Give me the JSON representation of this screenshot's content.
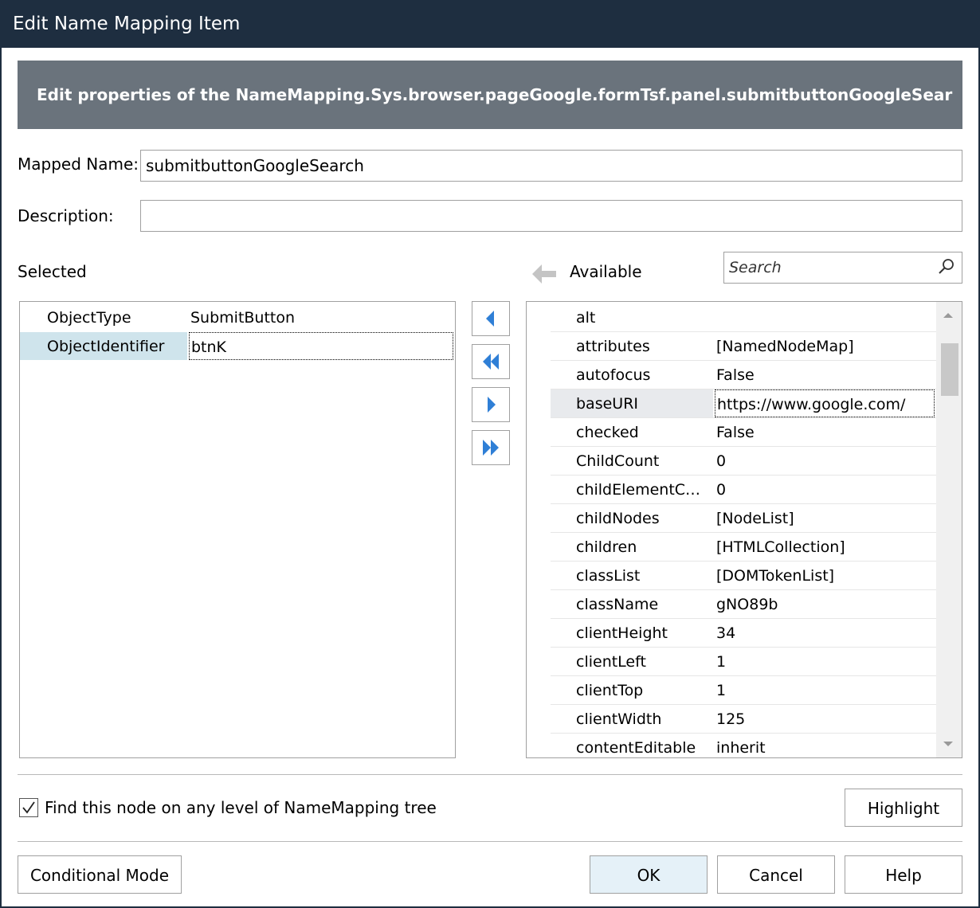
{
  "window": {
    "title": "Edit Name Mapping Item",
    "banner": "Edit properties of the NameMapping.Sys.browser.pageGoogle.formTsf.panel.submitbuttonGoogleSear"
  },
  "form": {
    "mapped_name_label": "Mapped Name:",
    "mapped_name_value": "submitbuttonGoogleSearch",
    "description_label": "Description:",
    "description_value": ""
  },
  "selected": {
    "label": "Selected",
    "rows": [
      {
        "name": "ObjectType",
        "value": "SubmitButton"
      },
      {
        "name": "ObjectIdentifier",
        "value": "btnK"
      }
    ]
  },
  "available": {
    "label": "Available",
    "search_placeholder": "Search",
    "rows": [
      {
        "name": "alt",
        "value": ""
      },
      {
        "name": "attributes",
        "value": "[NamedNodeMap]"
      },
      {
        "name": "autofocus",
        "value": "False"
      },
      {
        "name": "baseURI",
        "value": "https://www.google.com/"
      },
      {
        "name": "checked",
        "value": "False"
      },
      {
        "name": "ChildCount",
        "value": "0"
      },
      {
        "name": "childElementC…",
        "value": "0"
      },
      {
        "name": "childNodes",
        "value": "[NodeList]"
      },
      {
        "name": "children",
        "value": "[HTMLCollection]"
      },
      {
        "name": "classList",
        "value": "[DOMTokenList]"
      },
      {
        "name": "className",
        "value": "gNO89b"
      },
      {
        "name": "clientHeight",
        "value": "34"
      },
      {
        "name": "clientLeft",
        "value": "1"
      },
      {
        "name": "clientTop",
        "value": "1"
      },
      {
        "name": "clientWidth",
        "value": "125"
      },
      {
        "name": "contentEditable",
        "value": "inherit"
      }
    ]
  },
  "options": {
    "find_any_level_label": "Find this node on any level of NameMapping tree",
    "find_any_level_checked": true
  },
  "buttons": {
    "highlight": "Highlight",
    "conditional_mode": "Conditional Mode",
    "ok": "OK",
    "cancel": "Cancel",
    "help": "Help"
  },
  "colors": {
    "titlebar": "#1e2e40",
    "banner": "#6a737c",
    "arrow_blue": "#2f7fd6",
    "selected_row": "#cfe4ec"
  }
}
